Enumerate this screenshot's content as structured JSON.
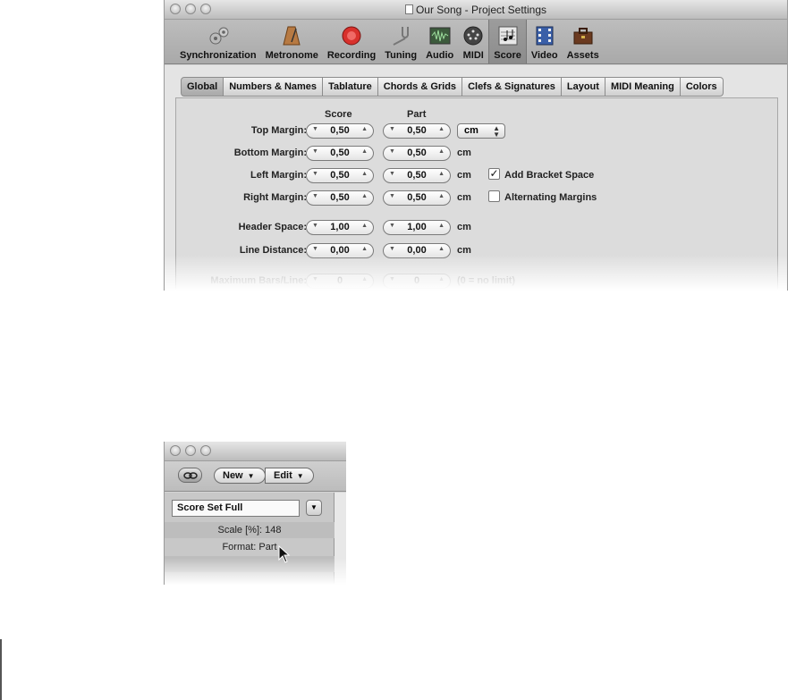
{
  "project_window": {
    "title": "Our Song - Project Settings",
    "toolbar": [
      {
        "label": "Synchronization",
        "icon": "gears-icon"
      },
      {
        "label": "Metronome",
        "icon": "metronome-icon"
      },
      {
        "label": "Recording",
        "icon": "record-icon"
      },
      {
        "label": "Tuning",
        "icon": "tuning-fork-icon"
      },
      {
        "label": "Audio",
        "icon": "audio-waveform-icon"
      },
      {
        "label": "MIDI",
        "icon": "midi-connector-icon"
      },
      {
        "label": "Score",
        "icon": "score-notes-icon",
        "selected": true
      },
      {
        "label": "Video",
        "icon": "film-icon"
      },
      {
        "label": "Assets",
        "icon": "briefcase-icon"
      }
    ],
    "tabs": [
      "Global",
      "Numbers & Names",
      "Tablature",
      "Chords & Grids",
      "Clefs & Signatures",
      "Layout",
      "MIDI Meaning",
      "Colors"
    ],
    "active_tab": "Global",
    "columns": {
      "score": "Score",
      "part": "Part"
    },
    "rows": [
      {
        "label": "Top Margin:",
        "score": "0,50",
        "part": "0,50"
      },
      {
        "label": "Bottom Margin:",
        "score": "0,50",
        "part": "0,50",
        "unit": "cm"
      },
      {
        "label": "Left Margin:",
        "score": "0,50",
        "part": "0,50",
        "unit": "cm"
      },
      {
        "label": "Right Margin:",
        "score": "0,50",
        "part": "0,50",
        "unit": "cm"
      },
      {
        "label": "Header Space:",
        "score": "1,00",
        "part": "1,00",
        "unit": "cm"
      },
      {
        "label": "Line Distance:",
        "score": "0,00",
        "part": "0,00",
        "unit": "cm"
      },
      {
        "label": "Maximum Bars/Line:",
        "score": "0",
        "part": "0",
        "unit": "(0 = no limit)"
      }
    ],
    "unit_select": "cm",
    "checkboxes": [
      {
        "label": "Add Bracket Space",
        "checked": true
      },
      {
        "label": "Alternating Margins",
        "checked": false
      }
    ]
  },
  "score_window": {
    "buttons": {
      "new": "New",
      "edit": "Edit"
    },
    "score_set": "Score Set Full",
    "scale": "Scale [%]: 148",
    "format": "Format: Part"
  },
  "colors": {
    "record_red": "#d8312c",
    "window_gray": "#d6d6d6"
  }
}
